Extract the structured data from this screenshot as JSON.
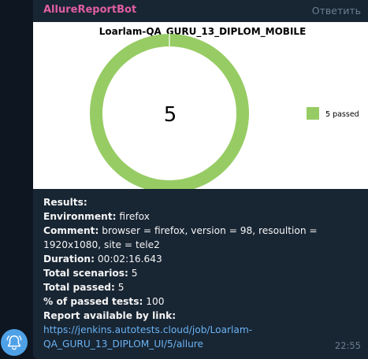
{
  "message": {
    "sender": "AllureReportBot",
    "reply_label": "Ответить",
    "time": "22:55",
    "lines": [
      {
        "label": "Results:",
        "value": ""
      },
      {
        "label": "Environment:",
        "value": " firefox"
      },
      {
        "label": "Comment:",
        "value": " browser = firefox, version = 98, resoultion = 1920x1080, site = tele2"
      },
      {
        "label": "Duration:",
        "value": " 00:02:16.643"
      },
      {
        "label": "Total scenarios:",
        "value": " 5"
      },
      {
        "label": "Total passed:",
        "value": " 5"
      },
      {
        "label": "% of passed tests:",
        "value": " 100"
      },
      {
        "label": "Report available by link:",
        "value": ""
      }
    ],
    "link": "https://jenkins.autotests.cloud/job/Loarlam-QA_GURU_13_DIPLOM_UI/5/allure"
  },
  "chart_data": {
    "type": "pie",
    "title": "Loarlam-QA_GURU_13_DIPLOM_MOBILE",
    "center_label": "5",
    "slices": [
      {
        "name": "5 passed",
        "value": 5,
        "color": "#97cc64"
      }
    ],
    "legend_position": "right"
  },
  "icons": {
    "avatar": "bell-icon"
  },
  "colors": {
    "background": "#0e1621",
    "bubble": "#182533",
    "sender": "#e05ea2",
    "link": "#6ab3f3",
    "passed": "#97cc64"
  }
}
